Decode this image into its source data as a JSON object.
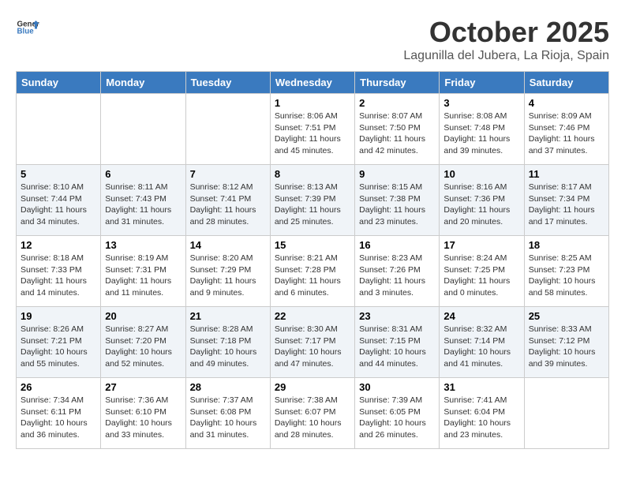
{
  "header": {
    "logo_general": "General",
    "logo_blue": "Blue",
    "month": "October 2025",
    "location": "Lagunilla del Jubera, La Rioja, Spain"
  },
  "days_of_week": [
    "Sunday",
    "Monday",
    "Tuesday",
    "Wednesday",
    "Thursday",
    "Friday",
    "Saturday"
  ],
  "weeks": [
    [
      {
        "day": "",
        "info": ""
      },
      {
        "day": "",
        "info": ""
      },
      {
        "day": "",
        "info": ""
      },
      {
        "day": "1",
        "info": "Sunrise: 8:06 AM\nSunset: 7:51 PM\nDaylight: 11 hours and 45 minutes."
      },
      {
        "day": "2",
        "info": "Sunrise: 8:07 AM\nSunset: 7:50 PM\nDaylight: 11 hours and 42 minutes."
      },
      {
        "day": "3",
        "info": "Sunrise: 8:08 AM\nSunset: 7:48 PM\nDaylight: 11 hours and 39 minutes."
      },
      {
        "day": "4",
        "info": "Sunrise: 8:09 AM\nSunset: 7:46 PM\nDaylight: 11 hours and 37 minutes."
      }
    ],
    [
      {
        "day": "5",
        "info": "Sunrise: 8:10 AM\nSunset: 7:44 PM\nDaylight: 11 hours and 34 minutes."
      },
      {
        "day": "6",
        "info": "Sunrise: 8:11 AM\nSunset: 7:43 PM\nDaylight: 11 hours and 31 minutes."
      },
      {
        "day": "7",
        "info": "Sunrise: 8:12 AM\nSunset: 7:41 PM\nDaylight: 11 hours and 28 minutes."
      },
      {
        "day": "8",
        "info": "Sunrise: 8:13 AM\nSunset: 7:39 PM\nDaylight: 11 hours and 25 minutes."
      },
      {
        "day": "9",
        "info": "Sunrise: 8:15 AM\nSunset: 7:38 PM\nDaylight: 11 hours and 23 minutes."
      },
      {
        "day": "10",
        "info": "Sunrise: 8:16 AM\nSunset: 7:36 PM\nDaylight: 11 hours and 20 minutes."
      },
      {
        "day": "11",
        "info": "Sunrise: 8:17 AM\nSunset: 7:34 PM\nDaylight: 11 hours and 17 minutes."
      }
    ],
    [
      {
        "day": "12",
        "info": "Sunrise: 8:18 AM\nSunset: 7:33 PM\nDaylight: 11 hours and 14 minutes."
      },
      {
        "day": "13",
        "info": "Sunrise: 8:19 AM\nSunset: 7:31 PM\nDaylight: 11 hours and 11 minutes."
      },
      {
        "day": "14",
        "info": "Sunrise: 8:20 AM\nSunset: 7:29 PM\nDaylight: 11 hours and 9 minutes."
      },
      {
        "day": "15",
        "info": "Sunrise: 8:21 AM\nSunset: 7:28 PM\nDaylight: 11 hours and 6 minutes."
      },
      {
        "day": "16",
        "info": "Sunrise: 8:23 AM\nSunset: 7:26 PM\nDaylight: 11 hours and 3 minutes."
      },
      {
        "day": "17",
        "info": "Sunrise: 8:24 AM\nSunset: 7:25 PM\nDaylight: 11 hours and 0 minutes."
      },
      {
        "day": "18",
        "info": "Sunrise: 8:25 AM\nSunset: 7:23 PM\nDaylight: 10 hours and 58 minutes."
      }
    ],
    [
      {
        "day": "19",
        "info": "Sunrise: 8:26 AM\nSunset: 7:21 PM\nDaylight: 10 hours and 55 minutes."
      },
      {
        "day": "20",
        "info": "Sunrise: 8:27 AM\nSunset: 7:20 PM\nDaylight: 10 hours and 52 minutes."
      },
      {
        "day": "21",
        "info": "Sunrise: 8:28 AM\nSunset: 7:18 PM\nDaylight: 10 hours and 49 minutes."
      },
      {
        "day": "22",
        "info": "Sunrise: 8:30 AM\nSunset: 7:17 PM\nDaylight: 10 hours and 47 minutes."
      },
      {
        "day": "23",
        "info": "Sunrise: 8:31 AM\nSunset: 7:15 PM\nDaylight: 10 hours and 44 minutes."
      },
      {
        "day": "24",
        "info": "Sunrise: 8:32 AM\nSunset: 7:14 PM\nDaylight: 10 hours and 41 minutes."
      },
      {
        "day": "25",
        "info": "Sunrise: 8:33 AM\nSunset: 7:12 PM\nDaylight: 10 hours and 39 minutes."
      }
    ],
    [
      {
        "day": "26",
        "info": "Sunrise: 7:34 AM\nSunset: 6:11 PM\nDaylight: 10 hours and 36 minutes."
      },
      {
        "day": "27",
        "info": "Sunrise: 7:36 AM\nSunset: 6:10 PM\nDaylight: 10 hours and 33 minutes."
      },
      {
        "day": "28",
        "info": "Sunrise: 7:37 AM\nSunset: 6:08 PM\nDaylight: 10 hours and 31 minutes."
      },
      {
        "day": "29",
        "info": "Sunrise: 7:38 AM\nSunset: 6:07 PM\nDaylight: 10 hours and 28 minutes."
      },
      {
        "day": "30",
        "info": "Sunrise: 7:39 AM\nSunset: 6:05 PM\nDaylight: 10 hours and 26 minutes."
      },
      {
        "day": "31",
        "info": "Sunrise: 7:41 AM\nSunset: 6:04 PM\nDaylight: 10 hours and 23 minutes."
      },
      {
        "day": "",
        "info": ""
      }
    ]
  ]
}
